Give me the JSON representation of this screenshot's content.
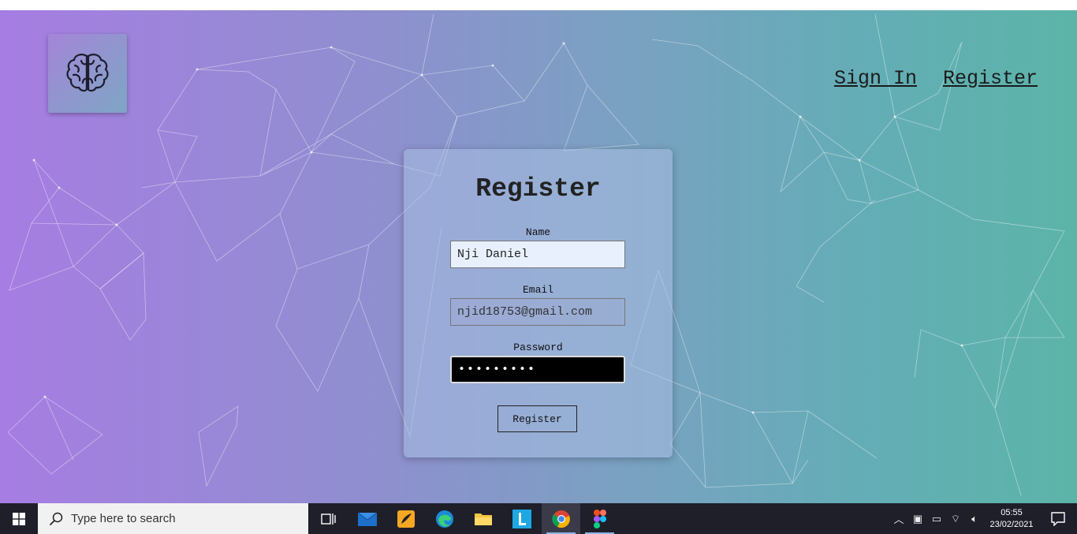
{
  "nav": {
    "signin_label": "Sign In",
    "register_label": "Register"
  },
  "form": {
    "title": "Register",
    "name_label": "Name",
    "name_value": "Nji Daniel",
    "email_label": "Email",
    "email_value": "njid18753@gmail.com",
    "password_label": "Password",
    "password_value": "•••••••••",
    "submit_label": "Register"
  },
  "taskbar": {
    "search_placeholder": "Type here to search",
    "time": "05:55",
    "date": "23/02/2021",
    "apps": [
      "task-view",
      "mail",
      "paint",
      "edge",
      "file-explorer",
      "l-app",
      "chrome",
      "figma"
    ]
  },
  "colors": {
    "gradient_left": "#a67de2",
    "gradient_right": "#5cb4a8",
    "taskbar": "#1f1f2a"
  }
}
